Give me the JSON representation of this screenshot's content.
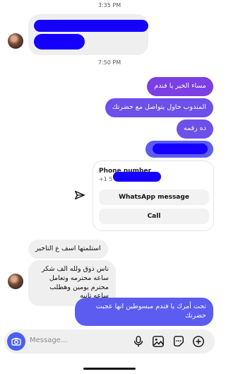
{
  "timestamps": {
    "first": "3:35 PM",
    "second": "7:50 PM"
  },
  "messages_outgoing": [
    "مساء الخير يا فندم",
    "المندوب حاول يتواصل مع حضرتك",
    "ده رقمه"
  ],
  "contact_card": {
    "title": "Phone number",
    "number_prefix": "+1 5",
    "whatsapp_label": "WhatsApp message",
    "call_label": "Call"
  },
  "messages_incoming": [
    "استلمتها اسف ع التاخير",
    "ناس ذوق ولله الف شكر ساعه محترمه وتعامل محترم يومين وهطلب ساعه تانيه"
  ],
  "last_outgoing": "تحت أمرك يا فندم مبسوطين انها عجبت حضرتك",
  "composer": {
    "placeholder": "Message..."
  },
  "icons": [
    "camera-icon",
    "mic-icon",
    "gallery-icon",
    "sticker-icon",
    "plus-icon",
    "share-icon"
  ],
  "colors": {
    "outgoing_top": "#7b3fe4",
    "outgoing_mid": "#6d4fe9",
    "outgoing_bottom": "#5c5cf0",
    "incoming": "#efefef",
    "redaction": "#1500ff"
  }
}
